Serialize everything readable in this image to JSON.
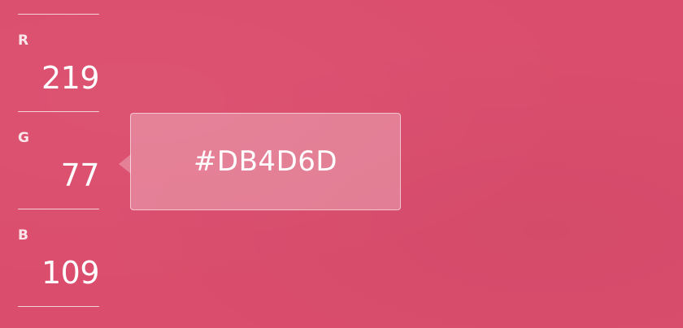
{
  "color": {
    "background": "#DB4D6D",
    "hex_label": "#DB4D6D"
  },
  "channels": [
    {
      "label": "R",
      "value": "219"
    },
    {
      "label": "G",
      "value": "77"
    },
    {
      "label": "B",
      "value": "109"
    }
  ]
}
